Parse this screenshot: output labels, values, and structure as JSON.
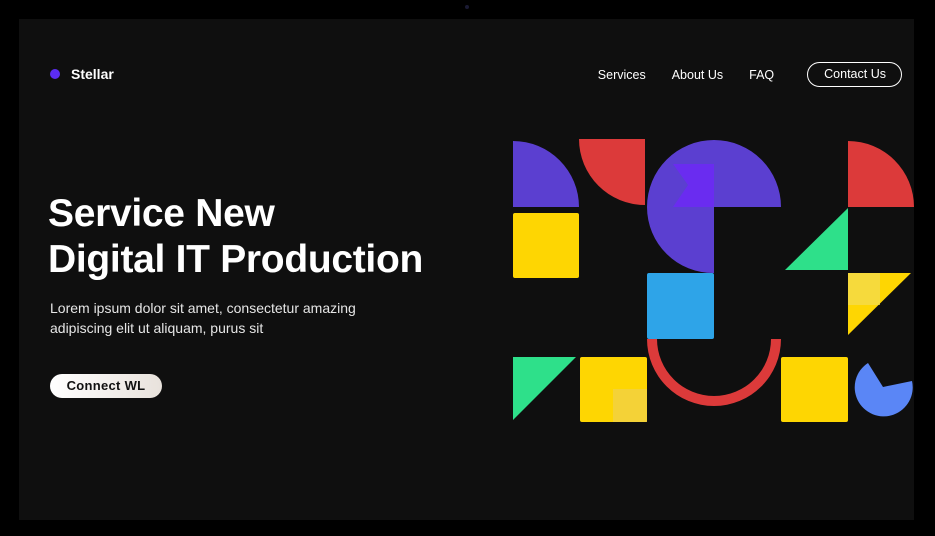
{
  "brand": {
    "name": "Stellar",
    "dot_color": "#5b2cf2"
  },
  "nav": {
    "links": [
      "Services",
      "About Us",
      "FAQ"
    ],
    "contact_label": "Contact Us"
  },
  "hero": {
    "title_line_1": "Service New",
    "title_line_2": "Digital IT Production",
    "description_line_1": "Lorem ipsum dolor sit amet, consectetur amazing",
    "description_line_2": "adipiscing elit ut aliquam, purus sit",
    "cta_label": "Connect  WL"
  },
  "palette": {
    "background": "#0f0f0f",
    "purple": "#5b3fd0",
    "red": "#dc3a3a",
    "yellow": "#fed602",
    "green": "#2ee08a",
    "blue": "#2ea4e8",
    "periwinkle": "#5a86f6"
  }
}
